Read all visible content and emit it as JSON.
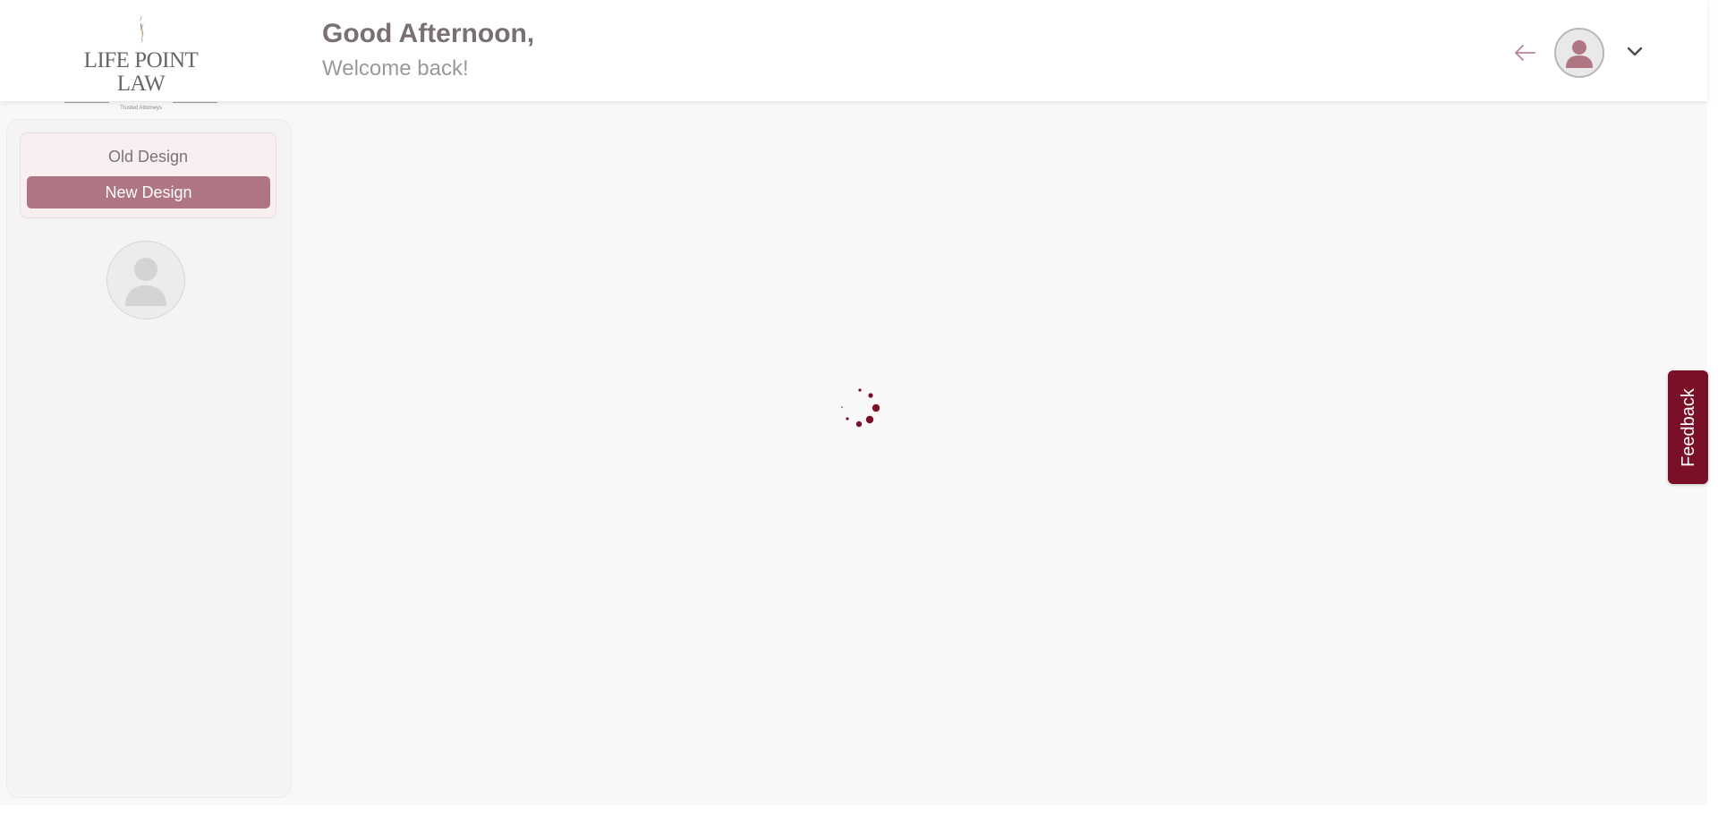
{
  "header": {
    "logo": {
      "name": "LIFE POINT LAW",
      "tagline": "Trusted Attorneys",
      "icon": "flame-logo-icon"
    },
    "greeting_title": "Good Afternoon,",
    "greeting_subtitle": "Welcome back!",
    "back_icon": "arrow-left-icon",
    "avatar_icon": "user-avatar-icon",
    "menu_icon": "chevron-down-icon"
  },
  "sidebar": {
    "design_switch": {
      "old_label": "Old Design",
      "new_label": "New Design",
      "selected": "New Design"
    },
    "avatar_icon": "user-avatar-icon"
  },
  "main": {
    "state": "loading",
    "loader_icon": "spinner-icon"
  },
  "feedback": {
    "label": "Feedback"
  },
  "colors": {
    "brand": "#7a1027",
    "accent": "#b07582",
    "arrow": "#b98390",
    "avatar_fill": "#b07582"
  }
}
